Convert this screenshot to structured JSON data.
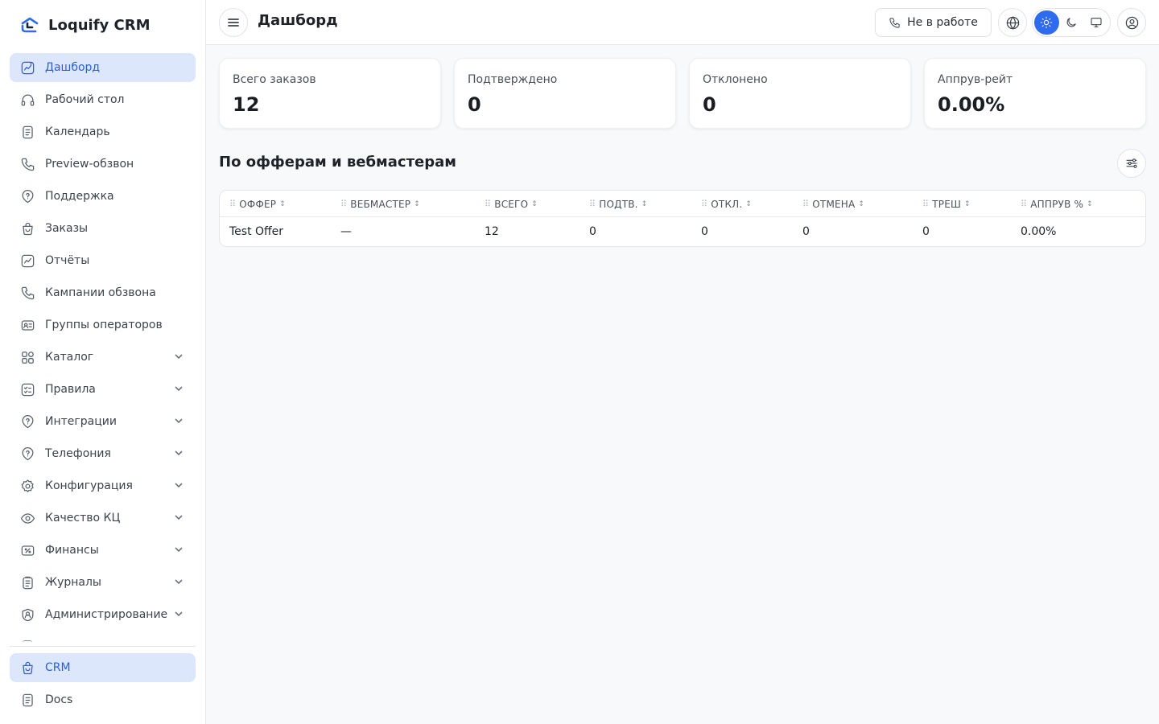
{
  "app": {
    "name": "Loquify CRM"
  },
  "sidebar": {
    "items": [
      {
        "label": "Дашборд",
        "icon": "chart-icon",
        "active": true,
        "expandable": false
      },
      {
        "label": "Рабочий стол",
        "icon": "headphones-icon",
        "active": false,
        "expandable": false
      },
      {
        "label": "Календарь",
        "icon": "document-icon",
        "active": false,
        "expandable": false
      },
      {
        "label": "Preview-обзвон",
        "icon": "phone-icon",
        "active": false,
        "expandable": false
      },
      {
        "label": "Поддержка",
        "icon": "support-icon",
        "active": false,
        "expandable": false
      },
      {
        "label": "Заказы",
        "icon": "bag-icon",
        "active": false,
        "expandable": false
      },
      {
        "label": "Отчёты",
        "icon": "report-icon",
        "active": false,
        "expandable": false
      },
      {
        "label": "Кампании обзвона",
        "icon": "phone-icon",
        "active": false,
        "expandable": false
      },
      {
        "label": "Группы операторов",
        "icon": "id-card-icon",
        "active": false,
        "expandable": false
      },
      {
        "label": "Каталог",
        "icon": "grid-icon",
        "active": false,
        "expandable": true
      },
      {
        "label": "Правила",
        "icon": "checklist-icon",
        "active": false,
        "expandable": true
      },
      {
        "label": "Интеграции",
        "icon": "support-icon",
        "active": false,
        "expandable": true
      },
      {
        "label": "Телефония",
        "icon": "support-icon",
        "active": false,
        "expandable": true
      },
      {
        "label": "Конфигурация",
        "icon": "gear-icon",
        "active": false,
        "expandable": true
      },
      {
        "label": "Качество КЦ",
        "icon": "eye-icon",
        "active": false,
        "expandable": true
      },
      {
        "label": "Финансы",
        "icon": "percent-icon",
        "active": false,
        "expandable": true
      },
      {
        "label": "Журналы",
        "icon": "clipboard-icon",
        "active": false,
        "expandable": true
      },
      {
        "label": "Администрирование",
        "icon": "user-shield-icon",
        "active": false,
        "expandable": true
      }
    ],
    "bottom": [
      {
        "label": "CRM",
        "icon": "bag-icon",
        "active": true
      },
      {
        "label": "Docs",
        "icon": "document-icon",
        "active": false
      }
    ]
  },
  "topbar": {
    "title": "Дашборд",
    "status_label": "Не в работе"
  },
  "stats": [
    {
      "label": "Всего заказов",
      "value": "12"
    },
    {
      "label": "Подтверждено",
      "value": "0"
    },
    {
      "label": "Отклонено",
      "value": "0"
    },
    {
      "label": "Аппрув-рейт",
      "value": "0.00%"
    }
  ],
  "section": {
    "title": "По офферам и вебмастерам"
  },
  "table": {
    "columns": [
      "ОФФЕР",
      "ВЕБМАСТЕР",
      "ВСЕГО",
      "ПОДТВ.",
      "ОТКЛ.",
      "ОТМЕНА",
      "ТРЕШ",
      "АППРУВ %"
    ],
    "rows": [
      [
        "Test Offer",
        "—",
        "12",
        "0",
        "0",
        "0",
        "0",
        "0.00%"
      ]
    ]
  },
  "colors": {
    "accent": "#2f6bf0",
    "active_bg": "#dde7fb",
    "active_text": "#2b5fd9"
  }
}
